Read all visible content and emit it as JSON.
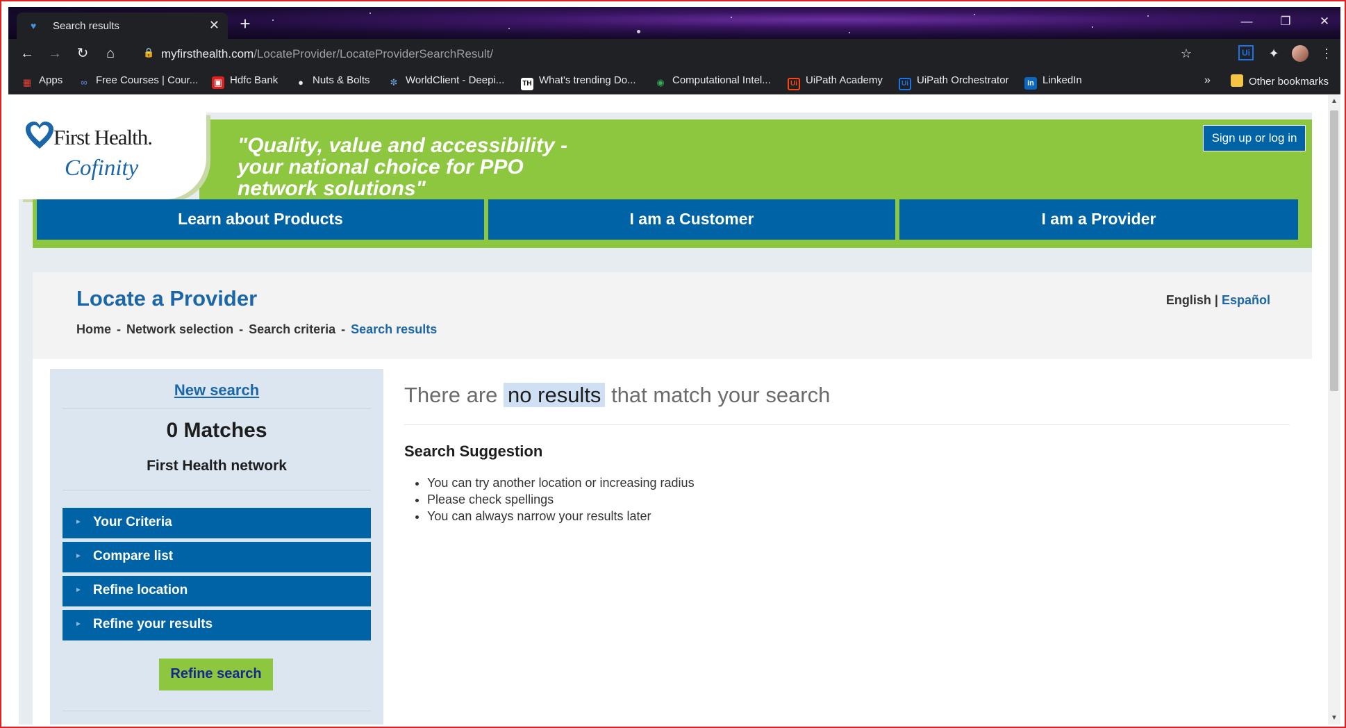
{
  "browser": {
    "tab": {
      "title": "Search results"
    },
    "url": {
      "domain": "myfirsthealth.com",
      "path": "/LocateProvider/LocateProviderSearchResult/"
    },
    "bookmarks": [
      {
        "label": "Apps",
        "icon": "apps-grid-icon",
        "color": "#ea4335"
      },
      {
        "label": "Free Courses | Cour...",
        "icon": "infinity-icon",
        "color": "#5c8ee6"
      },
      {
        "label": "Hdfc Bank",
        "icon": "hdfc-icon",
        "color": "#e02020"
      },
      {
        "label": "Nuts & Bolts",
        "icon": "globe-icon",
        "color": "#e8eaed"
      },
      {
        "label": "WorldClient - Deepi...",
        "icon": "worldclient-icon",
        "color": "#6fa8dc"
      },
      {
        "label": "What's trending Do...",
        "icon": "th-icon",
        "color": "#ffffff"
      },
      {
        "label": "Computational Intel...",
        "icon": "eye-icon",
        "color": "#34a853"
      },
      {
        "label": "UiPath Academy",
        "icon": "uipath-icon",
        "color": "#fa4616"
      },
      {
        "label": "UiPath Orchestrator",
        "icon": "uipath-icon",
        "color": "#1a73e8"
      },
      {
        "label": "LinkedIn",
        "icon": "linkedin-icon",
        "color": "#0a66c2"
      }
    ],
    "overflow_label": "»",
    "other_bookmarks": "Other bookmarks"
  },
  "site": {
    "brand": {
      "name": "First Health.",
      "sub": "Cofinity"
    },
    "tagline": "\"Quality, value and accessibility - your national choice for PPO network solutions\"",
    "signin_label": "Sign up or log in",
    "nav": [
      {
        "label": "Learn about Products"
      },
      {
        "label": "I am a Customer"
      },
      {
        "label": "I am a Provider"
      }
    ],
    "page_title": "Locate a Provider",
    "breadcrumb": [
      "Home",
      "Network selection",
      "Search criteria",
      "Search results"
    ],
    "breadcrumb_sep": "-",
    "lang": {
      "en": "English",
      "sep": "|",
      "es": "Español"
    },
    "sidebar": {
      "new_search": "New search",
      "matches": "0 Matches",
      "network": "First Health network",
      "sections": [
        "Your Criteria",
        "Compare list",
        "Refine location",
        "Refine your results"
      ],
      "refine_label": "Refine search"
    },
    "results": {
      "pre": "There are",
      "highlight": "no results",
      "post": "that match your search",
      "suggestion_title": "Search Suggestion",
      "suggestions": [
        "You can try another location or increasing radius",
        "Please check spellings",
        "You can always narrow your results later"
      ]
    }
  },
  "colors": {
    "brand_green": "#8dc63f",
    "brand_blue": "#0063a6",
    "link_blue": "#1b66a8"
  }
}
